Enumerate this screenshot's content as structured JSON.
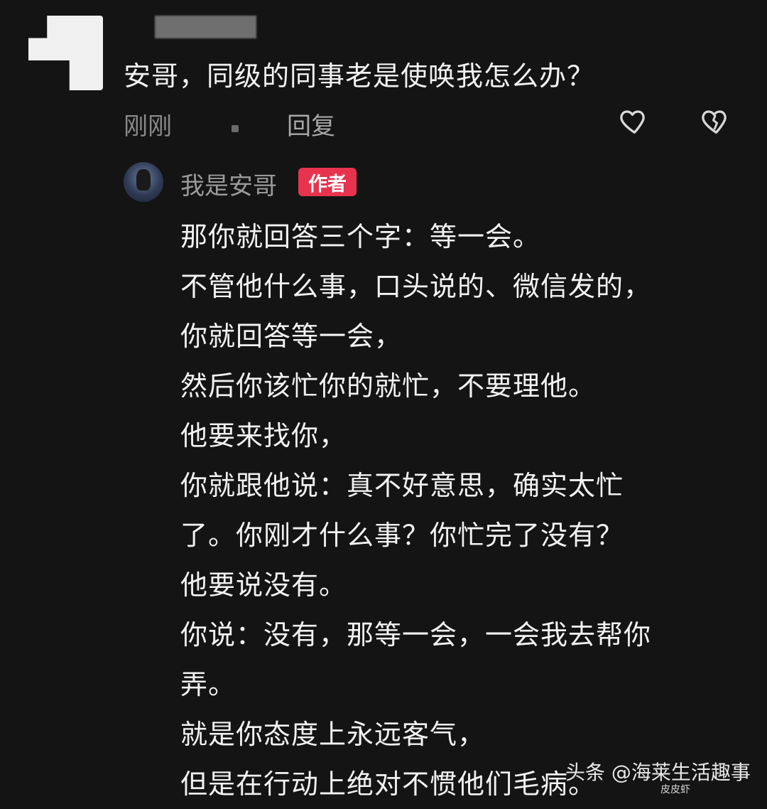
{
  "comment": {
    "text": "安哥，同级的同事老是使唤我怎么办？",
    "time": "刚刚",
    "reply_label": "回复"
  },
  "reply": {
    "author": "我是安哥",
    "badge": "作者",
    "lines": [
      "那你就回答三个字：等一会。",
      "不管他什么事，口头说的、微信发的，",
      "你就回答等一会，",
      "然后你该忙你的就忙，不要理他。",
      "他要来找你，",
      "你就跟他说：真不好意思，确实太忙",
      "了。你刚才什么事？你忙完了没有？",
      "他要说没有。",
      "你说：没有，那等一会，一会我去帮你",
      "弄。",
      "就是你态度上永远客气，",
      "但是在行动上绝对不惯他们毛病。"
    ]
  },
  "watermark": {
    "text": "头条 @海莱生活趣事",
    "sub": "皮皮虾"
  },
  "icons": {
    "like": "heart-outline-icon",
    "dislike": "broken-heart-icon"
  }
}
